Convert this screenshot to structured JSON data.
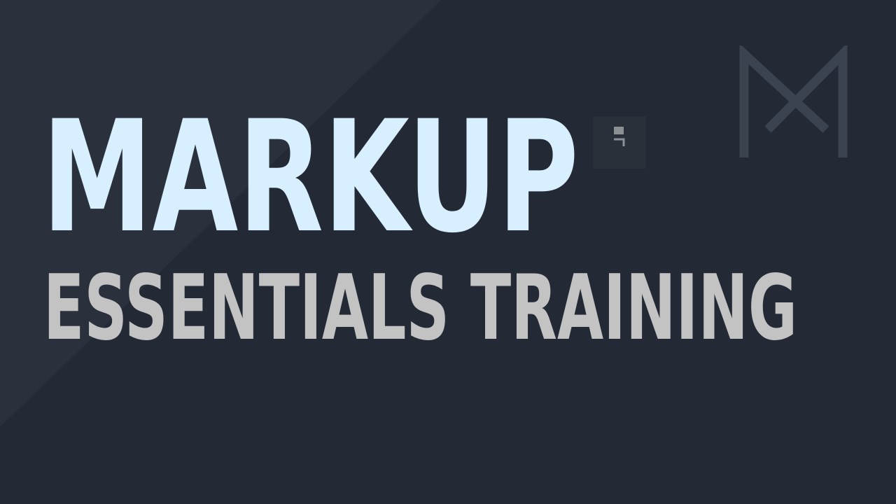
{
  "title": {
    "main": "MARKUP",
    "sub": "ESSENTIALS TRAINING"
  },
  "logo": {
    "icon": "m-monogram-icon"
  },
  "colors": {
    "background": "#242a35",
    "background_band": "#2a313c",
    "title_main": "#d8efff",
    "title_sub": "#c3c3c3",
    "logo": "#3b4350"
  }
}
